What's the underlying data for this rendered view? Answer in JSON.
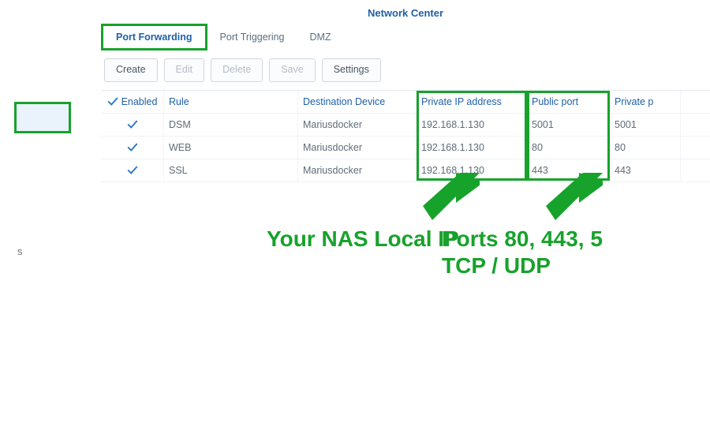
{
  "window_title": "Network Center",
  "tabs": {
    "port_forwarding": "Port Forwarding",
    "port_triggering": "Port Triggering",
    "dmz": "DMZ"
  },
  "toolbar": {
    "create": "Create",
    "edit": "Edit",
    "delete": "Delete",
    "save": "Save",
    "settings": "Settings"
  },
  "grid": {
    "headers": {
      "enabled": "Enabled",
      "rule": "Rule",
      "destination_device": "Destination Device",
      "private_ip": "Private IP address",
      "public_port": "Public port",
      "private_port": "Private p"
    },
    "rows": [
      {
        "enabled": true,
        "rule": "DSM",
        "device": "Mariusdocker",
        "private_ip": "192.168.1.130",
        "public_port": "5001",
        "private_port": "5001"
      },
      {
        "enabled": true,
        "rule": "WEB",
        "device": "Mariusdocker",
        "private_ip": "192.168.1.130",
        "public_port": "80",
        "private_port": "80"
      },
      {
        "enabled": true,
        "rule": "SSL",
        "device": "Mariusdocker",
        "private_ip": "192.168.1.130",
        "public_port": "443",
        "private_port": "443"
      }
    ]
  },
  "annotations": {
    "left": "Your NAS Local IP",
    "right": "Ports 80, 443, 5\nTCP / UDP"
  },
  "sidebar_hint": "s"
}
